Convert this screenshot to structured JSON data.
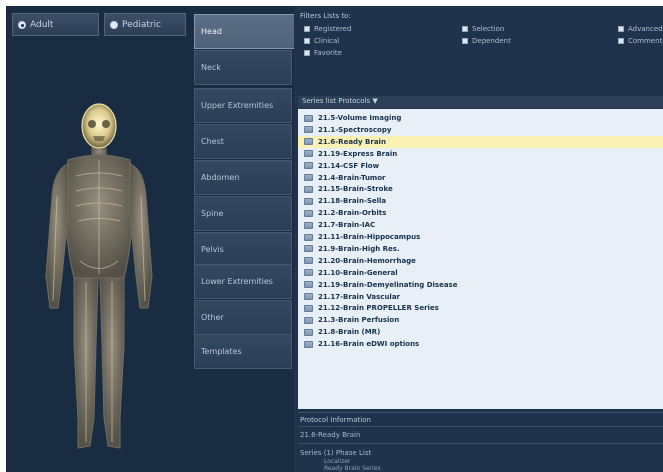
{
  "patient_type": {
    "options": [
      {
        "label": "Adult",
        "selected": true
      },
      {
        "label": "Pediatric",
        "selected": false
      }
    ]
  },
  "regions": [
    {
      "label": "Head",
      "active": true
    },
    {
      "label": "Neck",
      "active": false
    },
    {
      "label": "Upper Extremities",
      "active": false
    },
    {
      "label": "Chest",
      "active": false
    },
    {
      "label": "Abdomen",
      "active": false
    },
    {
      "label": "Spine",
      "active": false
    },
    {
      "label": "Pelvis",
      "active": false
    },
    {
      "label": "Lower Extremities",
      "active": false
    },
    {
      "label": "Other",
      "active": false
    },
    {
      "label": "Templates",
      "active": false
    }
  ],
  "filters": {
    "label": "Filters Lists to:",
    "checkboxes": [
      {
        "label": "Registered",
        "checked": false
      },
      {
        "label": "Clinical",
        "checked": false
      },
      {
        "label": "Favorite",
        "checked": false
      },
      {
        "label": "Selection",
        "checked": false
      },
      {
        "label": "Dependent",
        "checked": false
      },
      {
        "label": "Advanced",
        "checked": false
      },
      {
        "label": "Comments",
        "checked": false
      }
    ]
  },
  "protocol_list": {
    "header": "Series list Protocols ▼",
    "selected_index": 2,
    "items": [
      "21.5-Volume Imaging",
      "21.1-Spectroscopy",
      "21.6-Ready Brain",
      "21.19-Express Brain",
      "21.14-CSF Flow",
      "21.4-Brain-Tumor",
      "21.15-Brain-Stroke",
      "21.18-Brain-Sella",
      "21.2-Brain-Orbits",
      "21.7-Brain-IAC",
      "21.11-Brain-Hippocampus",
      "21.9-Brain-High Res.",
      "21.20-Brain-Hemorrhage",
      "21.10-Brain-General",
      "21.19-Brain-Demyelinating Disease",
      "21.17-Brain Vascular",
      "21.12-Brain PROPELLER Series",
      "21.3-Brain Perfusion",
      "21.8-Brain (MR)",
      "21.16-Brain eDWI options"
    ]
  },
  "protocol_info": {
    "label": "Protocol Information",
    "line1": "21.6-Ready Brain",
    "line2": "Series (1) Phase List",
    "line3": "Localizer",
    "line4": "Ready Brain Series"
  },
  "icons": {
    "protocol_item": "folder-icon",
    "filter_box": "checkbox-icon"
  },
  "colors": {
    "background": "#1b2f45",
    "selected_row": "#fbf1b4",
    "list_background": "#e9eff6"
  }
}
